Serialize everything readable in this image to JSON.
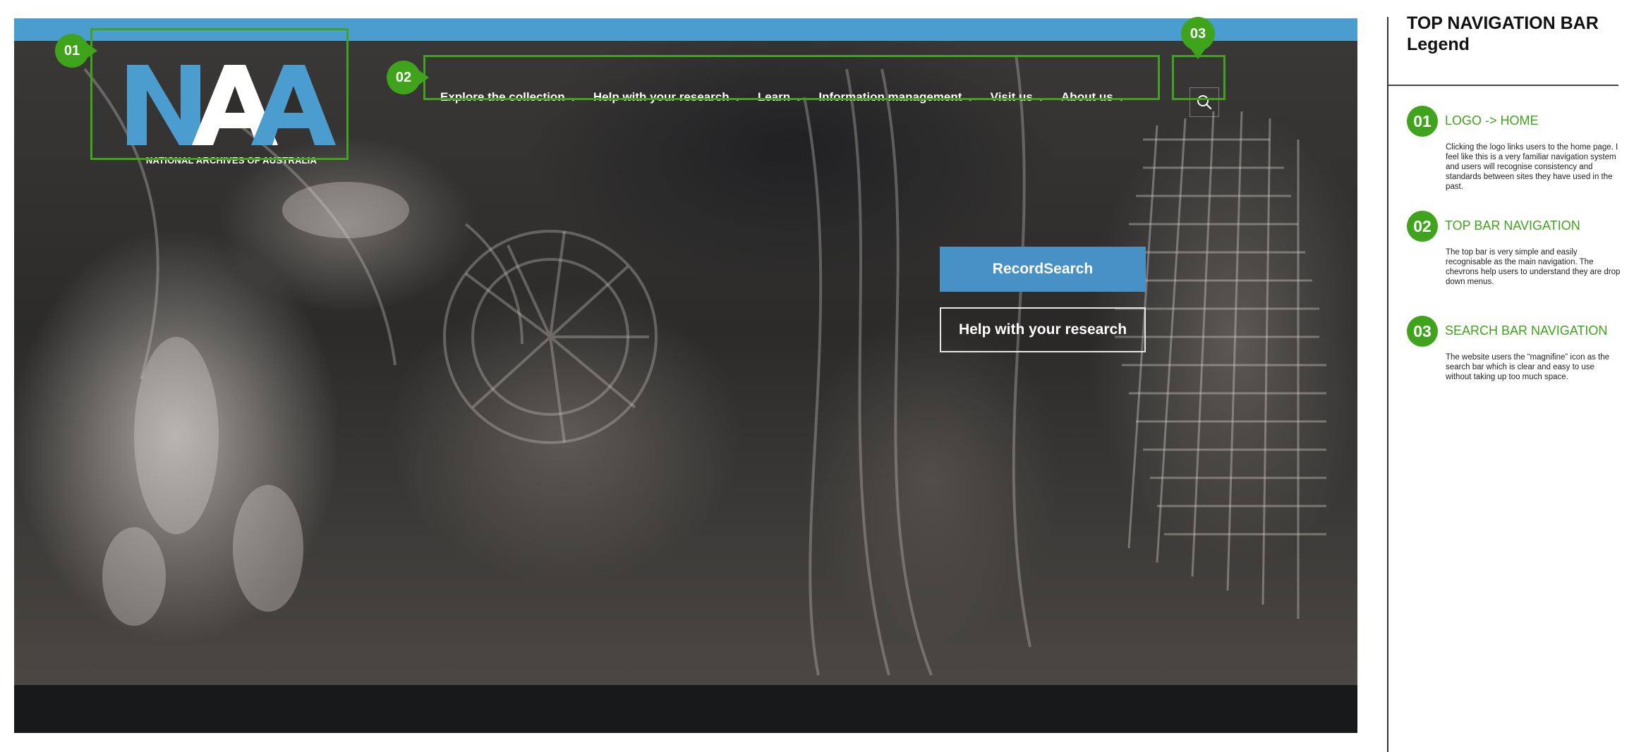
{
  "site": {
    "logo": {
      "letters": "NAA",
      "caption": "NATIONAL ARCHIVES OF AUSTRALIA"
    },
    "nav": [
      {
        "label": "Explore the collection"
      },
      {
        "label": "Help with your research"
      },
      {
        "label": "Learn"
      },
      {
        "label": "Information management"
      },
      {
        "label": "Visit us"
      },
      {
        "label": "About us"
      }
    ],
    "search_icon": "search-icon",
    "cta": {
      "primary": "RecordSearch",
      "secondary": "Help with your research"
    },
    "colors": {
      "brand_blue": "#4b9ccf",
      "button_blue": "#4891c6",
      "annotation_green": "#3fa31b"
    }
  },
  "annotations": {
    "markers": [
      "01",
      "02",
      "03"
    ]
  },
  "legend": {
    "title_line1": "TOP NAVIGATION BAR",
    "title_line2": "Legend",
    "items": [
      {
        "number": "01",
        "heading": "LOGO -> HOME",
        "description": "Clicking the logo links users to the home page. I feel like this is a very familiar navigation system and users will recognise consistency and standards between sites they have used in the past."
      },
      {
        "number": "02",
        "heading": "TOP BAR NAVIGATION",
        "description": "The top bar is very simple and easily recognisable as the main navigation. The chevrons help users to understand they are drop down menus."
      },
      {
        "number": "03",
        "heading": "SEARCH BAR NAVIGATION",
        "description": "The website users the “magnifine” icon as the search bar which is clear and easy to use without taking up too much space."
      }
    ]
  }
}
